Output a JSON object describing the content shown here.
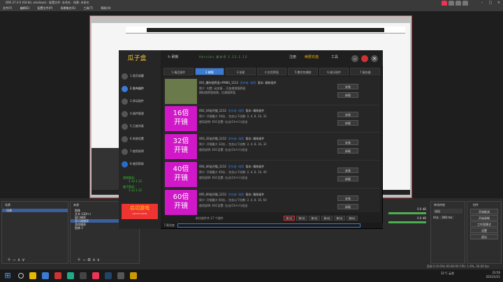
{
  "app": {
    "title": "OBS 27.0.0 (64-bit, windows) - 配置文件: 未命名 - 场景: 未命名",
    "menu": [
      "文件(F)",
      "编辑(E)",
      "配置文件(P)",
      "场景集合(S)",
      "工具(T)",
      "帮助(H)"
    ]
  },
  "docks": {
    "scenes_title": "场景",
    "scenes": [
      "场景"
    ],
    "sources_title": "来源",
    "sources": [
      "图像",
      "文本 (GDI+)",
      "窗口捕获",
      "显示器捕获",
      "游戏捕获",
      "图像 2"
    ],
    "sources_selected": 3,
    "mixer_left": "0.0 dB",
    "mixer_right": "0.0 dB",
    "transition_title": "转场特效",
    "transition_value": "淡出",
    "duration_label": "时长",
    "duration_value": "300 ms",
    "controls_title": "控件",
    "controls": [
      "开始推流",
      "开始录制",
      "工作室模式",
      "设置",
      "退出"
    ]
  },
  "status": {
    "text": "丢帧 0 (0.0%)    00:00:00    CPU: 1.6%, 30.00 fps"
  },
  "taskbar": {
    "weather": "31°C 云状",
    "time": "23:56",
    "date": "2021/5/21"
  },
  "dialog": {
    "logo": "瓜子盒",
    "refresh": "刷新",
    "version_title": "Version 版本号 1.12.1.12",
    "register": "注册",
    "vip": "续费充值",
    "tools": "工具",
    "sidebar": [
      "1.首页收藏",
      "2.发布插件",
      "3.多玩插件",
      "4.插件管理",
      "5.已装列表",
      "6.系统设置",
      "7.使用说明",
      "8.使用帮助"
    ],
    "sidebar_active": 1,
    "version_lines": [
      "游戏版本:",
      "1.12.1.12",
      "盒子版本:",
      "1.12.1.12"
    ],
    "launch": "启动游戏",
    "launch_sub": "Launch Game",
    "tabs": [
      "1.精品插件",
      "2.辅镜",
      "3.准星",
      "4.实用界面",
      "5.整合包辅助",
      "6.娱乐插件",
      "7.服务器"
    ],
    "tabs_active": 1,
    "items": [
      {
        "thumb": "",
        "title": "001_爆炸镜界面+PM80_1212",
        "author": "发布者: 瑞恩",
        "dl": "版本: 精致插件",
        "desc1": "简介: 内置: 动态镜... 可加视频镜界面",
        "desc2": "模拟镜界面效果，拉满镜界面",
        "btn1": "安装",
        "btn2": "卸载"
      },
      {
        "thumb": "16倍\n开镜",
        "title": "002_16倍开镜_1212",
        "author": "发布者: 瑞恩",
        "dl": "版本: 精致插件",
        "desc1": "简介: 开镜最大 16倍... 包含以下倍数: 2, 4, 8, 16, 32",
        "desc2": "使用说明: ESC设置: 右击(Ctrl+1)发送",
        "btn1": "安装",
        "btn2": "卸载"
      },
      {
        "thumb": "32倍\n开镜",
        "title": "003_32倍开镜_1212",
        "author": "发布者: 瑞恩",
        "dl": "版本: 精致插件",
        "desc1": "简介: 开镜最大 32倍... 包含以下倍数: 2, 4, 8, 16, 32",
        "desc2": "使用说明: ESC设置: 右击(Ctrl+1)发送",
        "btn1": "安装",
        "btn2": "卸载"
      },
      {
        "thumb": "40倍\n开镜",
        "title": "004_40倍开镜_1212",
        "author": "发布者: 瑞恩",
        "dl": "版本: 精致插件",
        "desc1": "简介: 开镜最大 40倍... 包含以下倍数: 2, 4, 8, 16, 40",
        "desc2": "使用说明: ESC设置: 右击(Ctrl+1)发送",
        "btn1": "安装",
        "btn2": "卸载"
      },
      {
        "thumb": "60倍\n开镜",
        "title": "005_60倍开镜_1212",
        "author": "发布者: 瑞恩",
        "dl": "版本: 精致插件",
        "desc1": "简介: 开镜最大 60倍... 包含以下倍数: 2, 4, 8, 16, 60",
        "desc2": "使用说明: ESC设置: 右击(Ctrl+1)发送",
        "btn1": "安装",
        "btn2": "卸载"
      }
    ],
    "pager_text": "前往插件共 17 个插件",
    "pages": [
      "第1页",
      "第2页",
      "第3页",
      "第4页",
      "第5页",
      "第6页"
    ],
    "pages_active": 0,
    "download_label": "下载进度"
  }
}
